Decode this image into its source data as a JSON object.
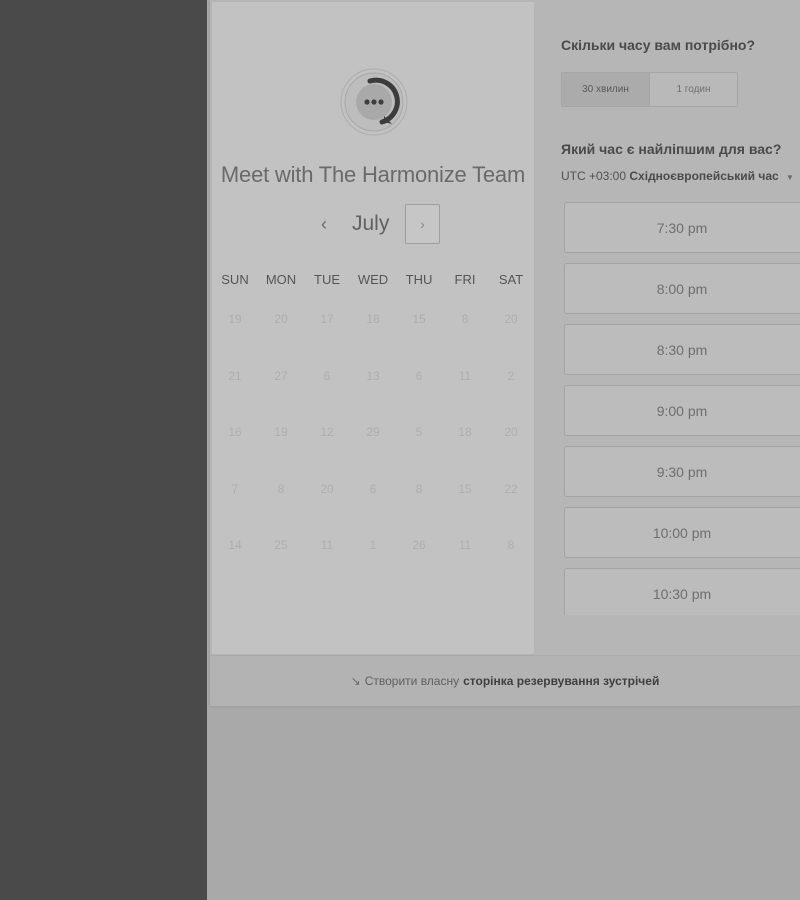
{
  "widget": {
    "title": "Meet with The Harmonize Team",
    "month": "July",
    "prev_icon": "‹",
    "next_icon": "›",
    "weekdays": [
      "SUN",
      "MON",
      "TUE",
      "WED",
      "THU",
      "FRI",
      "SAT"
    ],
    "calendar_rows": [
      [
        "19",
        "20",
        "17",
        "18",
        "15",
        "8",
        "20"
      ],
      [
        "21",
        "27",
        "6",
        "13",
        "6",
        "11",
        "2"
      ],
      [
        "16",
        "19",
        "12",
        "29",
        "5",
        "18",
        "20"
      ],
      [
        "7",
        "8",
        "20",
        "6",
        "8",
        "15",
        "22"
      ],
      [
        "14",
        "25",
        "11",
        "1",
        "26",
        "11",
        "8"
      ]
    ]
  },
  "booking": {
    "duration_question": "Скільки часу вам потрібно?",
    "durations": [
      "30 хвилин",
      "1 годин"
    ],
    "selected_duration": "30 хвилин",
    "time_question": "Який час є найліпшим для вас?",
    "timezone_offset": "UTC +03:00",
    "timezone_name": "Східноєвропейський час",
    "timezone_caret": "▼",
    "slots": [
      "7:30 pm",
      "8:00 pm",
      "8:30 pm",
      "9:00 pm",
      "9:30 pm",
      "10:00 pm",
      "10:30 pm"
    ]
  },
  "footer": {
    "icon": "↘",
    "text": "Створити власну",
    "link": "сторінка резервування зустрічей"
  }
}
